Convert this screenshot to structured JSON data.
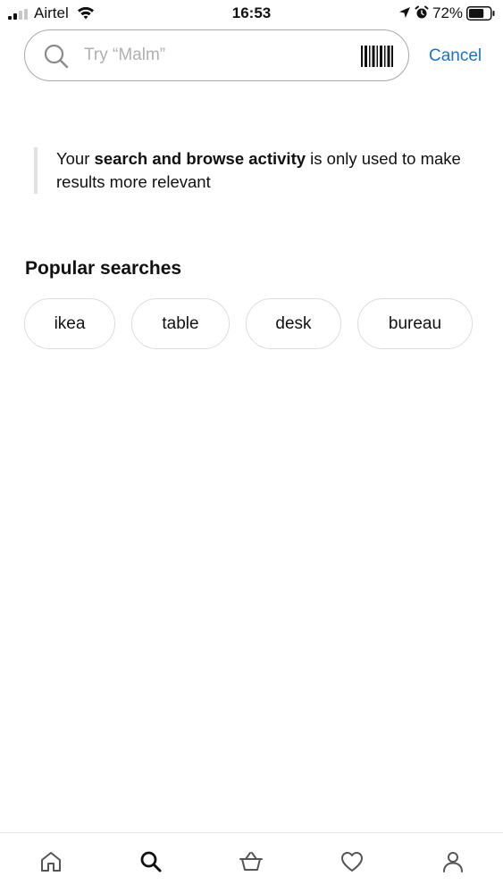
{
  "status_bar": {
    "carrier": "Airtel",
    "time": "16:53",
    "battery_percent": "72%",
    "battery_level": 0.72
  },
  "search": {
    "placeholder": "Try “Malm”",
    "value": "",
    "cancel_label": "Cancel"
  },
  "notice": {
    "prefix": "Your ",
    "bold": "search and browse activity",
    "suffix": " is only used to make results more relevant"
  },
  "popular": {
    "title": "Popular searches",
    "chips": [
      "ikea",
      "table",
      "desk",
      "bureau"
    ]
  },
  "tab_bar": {
    "items": [
      "home-icon",
      "search-icon",
      "basket-icon",
      "heart-icon",
      "profile-icon"
    ],
    "active": "search-icon",
    "active_color": "#111111",
    "inactive_color": "#555555"
  },
  "colors": {
    "accent": "#1b73c5",
    "placeholder": "#b0b0b0"
  }
}
